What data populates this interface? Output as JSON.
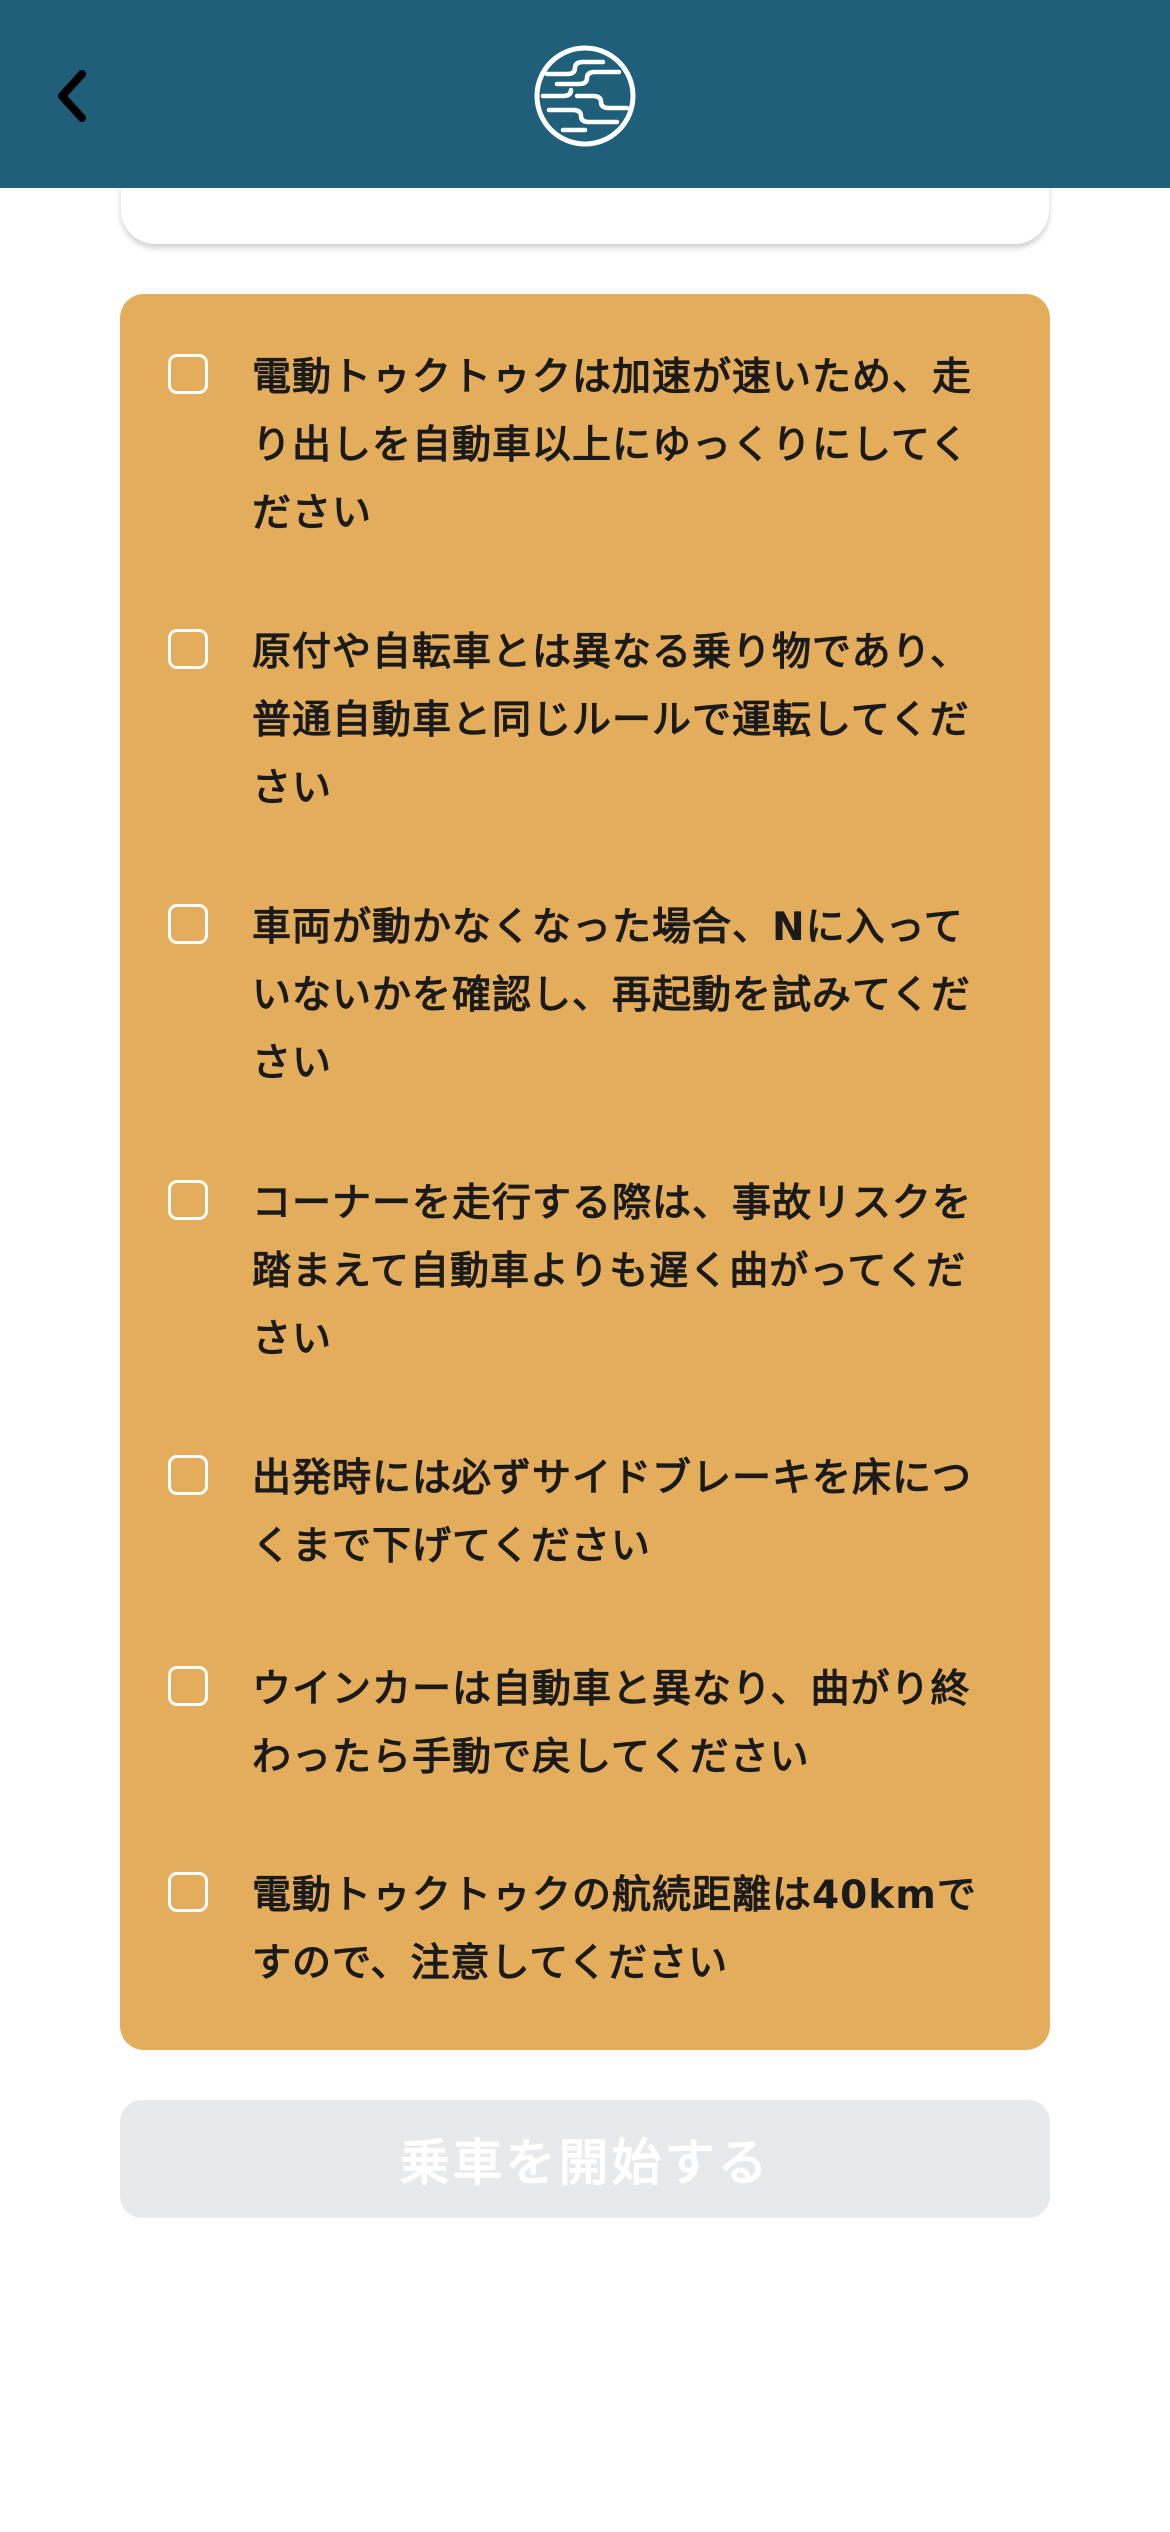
{
  "header": {
    "back_icon": "chevron-left-icon",
    "logo_icon": "cloud-emblem-logo"
  },
  "checklist": {
    "items": [
      {
        "label": "電動トゥクトゥクは加速が速いため、走り出しを自動車以上にゆっくりにしてください",
        "checked": false
      },
      {
        "label": "原付や自転車とは異なる乗り物であり、普通自動車と同じルールで運転してください",
        "checked": false
      },
      {
        "label": "車両が動かなくなった場合、Nに入っていないかを確認し、再起動を試みてください",
        "checked": false
      },
      {
        "label": "コーナーを走行する際は、事故リスクを踏まえて自動車よりも遅く曲がってください",
        "checked": false
      },
      {
        "label": "出発時には必ずサイドブレーキを床につくまで下げてください",
        "checked": false
      },
      {
        "label": "ウインカーは自動車と異なり、曲がり終わったら手動で戻してください",
        "checked": false
      },
      {
        "label": "電動トゥクトゥクの航続距離は40kmですので、注意してください",
        "checked": false
      }
    ]
  },
  "actions": {
    "start_label": "乗車を開始する",
    "start_enabled": false
  },
  "colors": {
    "header_bg": "#1f5f79",
    "panel_bg": "#e3ad5c",
    "button_disabled_bg": "#e8e9ec"
  }
}
